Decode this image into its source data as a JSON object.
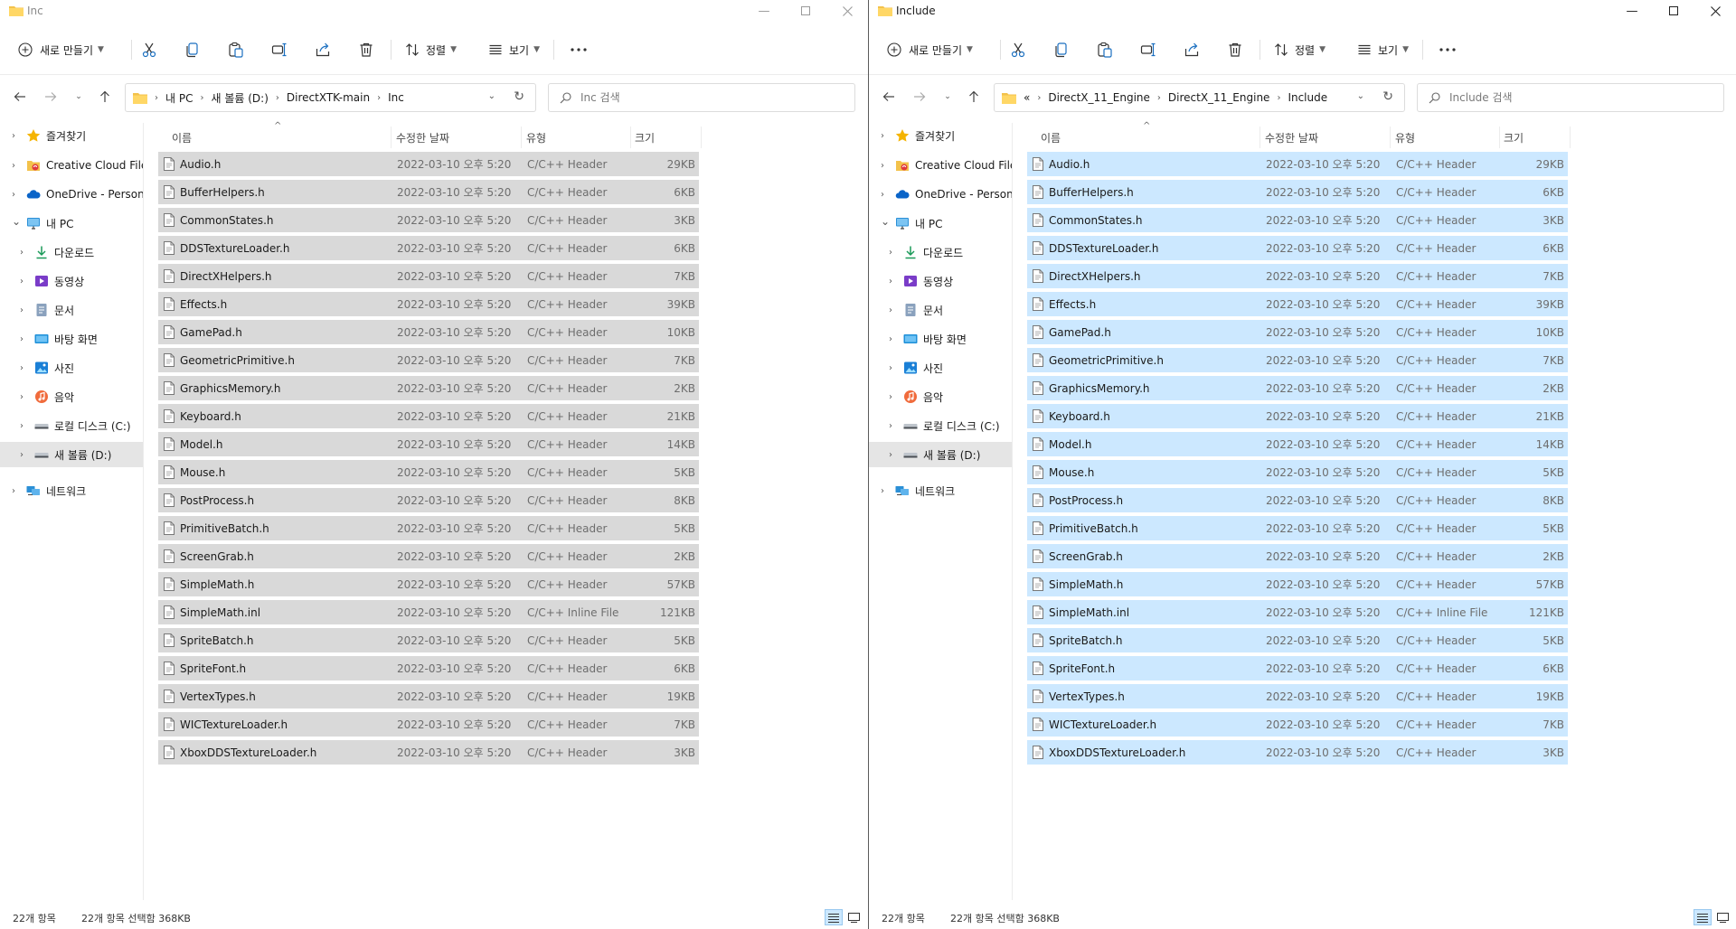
{
  "toolbar": {
    "new_label": "새로 만들기",
    "sort_label": "정렬",
    "view_label": "보기"
  },
  "columns": {
    "name": "이름",
    "date": "수정한 날짜",
    "type": "유형",
    "size": "크기"
  },
  "nav": {
    "items": [
      {
        "label": "즐겨찾기",
        "icon": "star-icon"
      },
      {
        "label": "Creative Cloud Files",
        "icon": "creative-cloud-icon"
      },
      {
        "label": "OneDrive - Persona",
        "icon": "onedrive-icon"
      },
      {
        "label": "내 PC",
        "icon": "pc-icon"
      },
      {
        "label": "다운로드",
        "icon": "download-icon"
      },
      {
        "label": "동영상",
        "icon": "video-icon"
      },
      {
        "label": "문서",
        "icon": "document-icon"
      },
      {
        "label": "바탕 화면",
        "icon": "desktop-icon"
      },
      {
        "label": "사진",
        "icon": "picture-icon"
      },
      {
        "label": "음악",
        "icon": "music-icon"
      },
      {
        "label": "로컬 디스크 (C:)",
        "icon": "drive-icon"
      },
      {
        "label": "새 볼륨 (D:)",
        "icon": "drive-icon"
      },
      {
        "label": "네트워크",
        "icon": "network-icon"
      }
    ]
  },
  "files": [
    {
      "name": "Audio.h",
      "date": "2022-03-10 오후 5:20",
      "type": "C/C++ Header",
      "size": "29KB"
    },
    {
      "name": "BufferHelpers.h",
      "date": "2022-03-10 오후 5:20",
      "type": "C/C++ Header",
      "size": "6KB"
    },
    {
      "name": "CommonStates.h",
      "date": "2022-03-10 오후 5:20",
      "type": "C/C++ Header",
      "size": "3KB"
    },
    {
      "name": "DDSTextureLoader.h",
      "date": "2022-03-10 오후 5:20",
      "type": "C/C++ Header",
      "size": "6KB"
    },
    {
      "name": "DirectXHelpers.h",
      "date": "2022-03-10 오후 5:20",
      "type": "C/C++ Header",
      "size": "7KB"
    },
    {
      "name": "Effects.h",
      "date": "2022-03-10 오후 5:20",
      "type": "C/C++ Header",
      "size": "39KB"
    },
    {
      "name": "GamePad.h",
      "date": "2022-03-10 오후 5:20",
      "type": "C/C++ Header",
      "size": "10KB"
    },
    {
      "name": "GeometricPrimitive.h",
      "date": "2022-03-10 오후 5:20",
      "type": "C/C++ Header",
      "size": "7KB"
    },
    {
      "name": "GraphicsMemory.h",
      "date": "2022-03-10 오후 5:20",
      "type": "C/C++ Header",
      "size": "2KB"
    },
    {
      "name": "Keyboard.h",
      "date": "2022-03-10 오후 5:20",
      "type": "C/C++ Header",
      "size": "21KB"
    },
    {
      "name": "Model.h",
      "date": "2022-03-10 오후 5:20",
      "type": "C/C++ Header",
      "size": "14KB"
    },
    {
      "name": "Mouse.h",
      "date": "2022-03-10 오후 5:20",
      "type": "C/C++ Header",
      "size": "5KB"
    },
    {
      "name": "PostProcess.h",
      "date": "2022-03-10 오후 5:20",
      "type": "C/C++ Header",
      "size": "8KB"
    },
    {
      "name": "PrimitiveBatch.h",
      "date": "2022-03-10 오후 5:20",
      "type": "C/C++ Header",
      "size": "5KB"
    },
    {
      "name": "ScreenGrab.h",
      "date": "2022-03-10 오후 5:20",
      "type": "C/C++ Header",
      "size": "2KB"
    },
    {
      "name": "SimpleMath.h",
      "date": "2022-03-10 오후 5:20",
      "type": "C/C++ Header",
      "size": "57KB"
    },
    {
      "name": "SimpleMath.inl",
      "date": "2022-03-10 오후 5:20",
      "type": "C/C++ Inline File",
      "size": "121KB"
    },
    {
      "name": "SpriteBatch.h",
      "date": "2022-03-10 오후 5:20",
      "type": "C/C++ Header",
      "size": "5KB"
    },
    {
      "name": "SpriteFont.h",
      "date": "2022-03-10 오후 5:20",
      "type": "C/C++ Header",
      "size": "6KB"
    },
    {
      "name": "VertexTypes.h",
      "date": "2022-03-10 오후 5:20",
      "type": "C/C++ Header",
      "size": "19KB"
    },
    {
      "name": "WICTextureLoader.h",
      "date": "2022-03-10 오후 5:20",
      "type": "C/C++ Header",
      "size": "7KB"
    },
    {
      "name": "XboxDDSTextureLoader.h",
      "date": "2022-03-10 오후 5:20",
      "type": "C/C++ Header",
      "size": "3KB"
    }
  ],
  "windows": [
    {
      "title": "Inc",
      "breadcrumb": [
        "내 PC",
        "새 볼륨 (D:)",
        "DirectXTK-main",
        "Inc"
      ],
      "search_placeholder": "Inc 검색",
      "selection_color": "#d9d9d9",
      "status": {
        "count": "22개 항목",
        "selected": "22개 항목 선택함 368KB"
      }
    },
    {
      "title": "Include",
      "breadcrumb_prefix": "«",
      "breadcrumb": [
        "DirectX_11_Engine",
        "DirectX_11_Engine",
        "Include"
      ],
      "search_placeholder": "Include 검색",
      "selection_color": "#cce8ff",
      "status": {
        "count": "22개 항목",
        "selected": "22개 항목 선택함 368KB"
      }
    }
  ]
}
